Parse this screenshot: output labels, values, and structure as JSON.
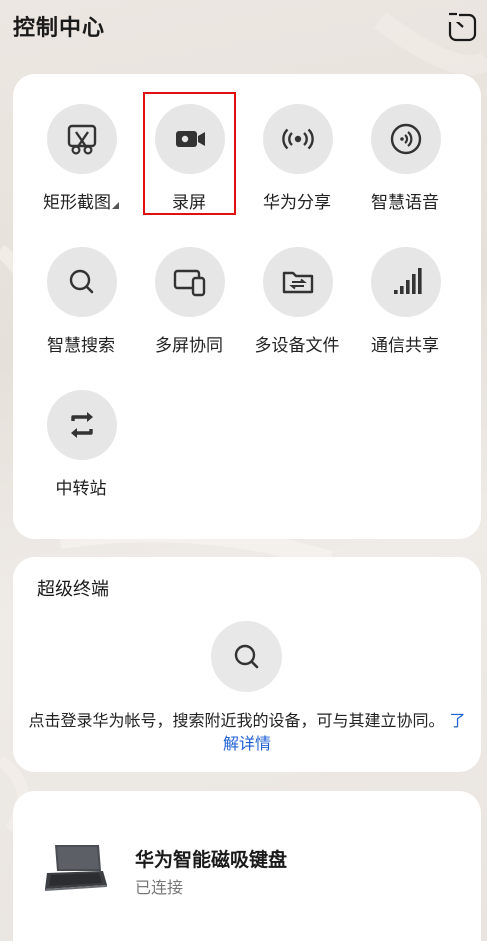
{
  "header": {
    "title": "控制中心"
  },
  "shortcuts": [
    {
      "label": "矩形截图"
    },
    {
      "label": "录屏"
    },
    {
      "label": "华为分享"
    },
    {
      "label": "智慧语音"
    },
    {
      "label": "智慧搜索"
    },
    {
      "label": "多屏协同"
    },
    {
      "label": "多设备文件"
    },
    {
      "label": "通信共享"
    },
    {
      "label": "中转站"
    }
  ],
  "super_device": {
    "title": "超级终端",
    "description": "点击登录华为帐号，搜索附近我的设备，可与其建立协同。",
    "link": "了解详情"
  },
  "device": {
    "name": "华为智能磁吸键盘",
    "status": "已连接"
  },
  "colors": {
    "accent_link": "#1f5fd6",
    "highlight": "#e01010",
    "icon_circle": "#e6e6e6"
  }
}
